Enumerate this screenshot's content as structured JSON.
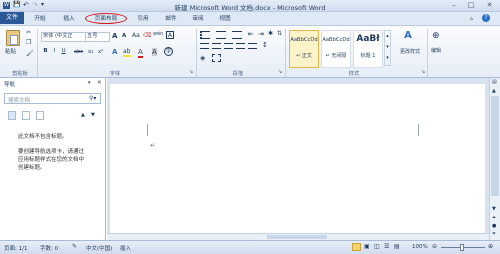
{
  "window": {
    "title": "新建 Microsoft Word 文档.docx - Microsoft Word",
    "quick_access": [
      "W",
      "💾",
      "↶",
      "↷",
      "▾"
    ]
  },
  "tabs": [
    {
      "label": "文件"
    },
    {
      "label": "开始"
    },
    {
      "label": "插入"
    },
    {
      "label": "页面布局"
    },
    {
      "label": "引用"
    },
    {
      "label": "邮件"
    },
    {
      "label": "审阅"
    },
    {
      "label": "视图"
    }
  ],
  "ribbon": {
    "clipboard": {
      "paste": "粘贴",
      "label": "剪贴板"
    },
    "font": {
      "name": "宋体 (中文正",
      "size": "五号",
      "label": "字体",
      "bold": "B",
      "italic": "I",
      "underline": "U",
      "strike": "abc",
      "sub": "x₂",
      "sup": "x²",
      "grow": "A",
      "shrink": "A",
      "aa": "Aa",
      "wen": "wén",
      "A_box": "A"
    },
    "paragraph": {
      "label": "段落"
    },
    "styles": {
      "label": "样式",
      "items": [
        {
          "preview": "AaBbCcDd",
          "name": "↵ 正文"
        },
        {
          "preview": "AaBbCcDd",
          "name": "↵ 无间隔"
        },
        {
          "preview": "AaBł",
          "name": "标题 1"
        }
      ],
      "change": "更改样式"
    },
    "editing": {
      "label": "编辑"
    }
  },
  "nav": {
    "title": "导航",
    "search_placeholder": "搜索文档",
    "message1": "此文档不包含标题。",
    "message2": "要创建导航选项卡，请通过在文档中为标题应用标题样式来创建标题。",
    "message2_lines": [
      "要创建导航选项卡，请通过",
      "应用标题样式在您的文档中",
      "创建标题。"
    ]
  },
  "status": {
    "page": "页面: 1/1",
    "words": "字数: 0",
    "lang": "中文(中国)",
    "mode": "插入",
    "zoom": "100%"
  },
  "colors": {
    "accent": "#2b5797",
    "highlight_circle": "#d21b1b"
  }
}
